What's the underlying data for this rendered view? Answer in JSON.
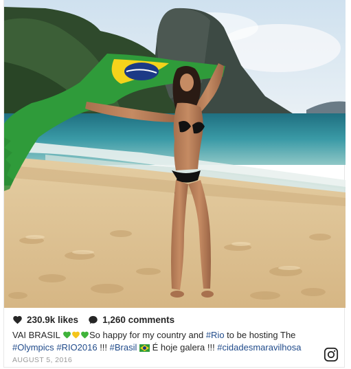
{
  "post": {
    "likes": "230.9k likes",
    "comments": "1,260 comments",
    "caption_lead": "VAI BRASIL",
    "caption_emojis": [
      "green-heart-icon",
      "yellow-heart-icon",
      "green-heart-icon"
    ],
    "caption_1": "So happy for my country and ",
    "tag_rio": "#Rio",
    "caption_2": " to be hosting The",
    "tag_olympics": "#Olympics",
    "tag_rio2016": "#RIO2016",
    "caption_3": " !!! ",
    "tag_brasil": "#Brasil",
    "caption_4": " É hoje galera !!! ",
    "tag_city": "#cidadesmaravilhosa",
    "date": "AUGUST 5, 2016"
  },
  "colors": {
    "hashtag": "#1f4a8a",
    "text": "#262626",
    "muted": "#999999",
    "flag_green": "#2f9b3a",
    "flag_yellow": "#f4d31b",
    "flag_blue": "#1c3a86"
  },
  "icons": {
    "heart": "heart-icon",
    "comment": "comment-bubble-icon",
    "instagram": "instagram-logo-icon",
    "flag": "brazil-flag-icon"
  }
}
